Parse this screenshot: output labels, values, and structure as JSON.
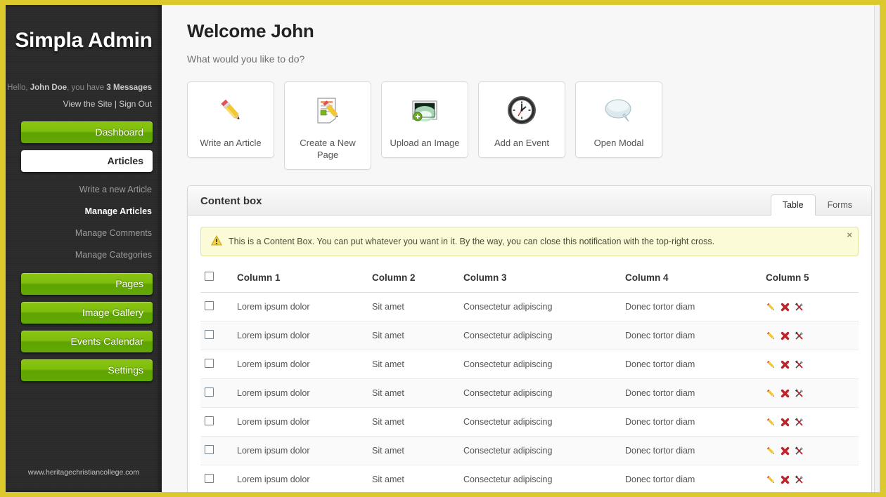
{
  "sidebar": {
    "brand": "Simpla Admin",
    "greeting_prefix": "Hello,",
    "user_name": "John Doe",
    "greeting_middle": ", you have",
    "messages": "3 Messages",
    "view_site": "View the Site",
    "separator": "|",
    "sign_out": "Sign Out",
    "nav": [
      {
        "label": "Dashboard",
        "type": "green"
      },
      {
        "label": "Articles",
        "type": "white-active"
      }
    ],
    "sub_items": [
      {
        "label": "Write a new Article",
        "current": false
      },
      {
        "label": "Manage Articles",
        "current": true
      },
      {
        "label": "Manage Comments",
        "current": false
      },
      {
        "label": "Manage Categories",
        "current": false
      }
    ],
    "nav_bottom": [
      {
        "label": "Pages"
      },
      {
        "label": "Image Gallery"
      },
      {
        "label": "Events Calendar"
      },
      {
        "label": "Settings"
      }
    ],
    "footer": "www.heritagechristiancollege.com"
  },
  "main": {
    "welcome": "Welcome John",
    "subtitle": "What would you like to do?",
    "cards": [
      {
        "label": "Write an Article",
        "icon": "pencil-icon"
      },
      {
        "label": "Create a New Page",
        "icon": "page-edit-icon"
      },
      {
        "label": "Upload an Image",
        "icon": "image-add-icon"
      },
      {
        "label": "Add an Event",
        "icon": "clock-icon"
      },
      {
        "label": "Open Modal",
        "icon": "speech-bubble-icon"
      }
    ],
    "contentbox": {
      "title": "Content box",
      "tabs": [
        {
          "label": "Table",
          "active": true
        },
        {
          "label": "Forms",
          "active": false
        }
      ],
      "notice": {
        "text": "This is a Content Box. You can put whatever you want in it. By the way, you can close this notification with the top-right cross.",
        "close_label": "×",
        "icon": "warning-triangle-icon"
      },
      "table": {
        "headers": [
          "Column 1",
          "Column 2",
          "Column 3",
          "Column 4",
          "Column 5"
        ],
        "rows": [
          {
            "c1": "Lorem ipsum dolor",
            "c2": "Sit amet",
            "c3": "Consectetur adipiscing",
            "c4": "Donec tortor diam"
          },
          {
            "c1": "Lorem ipsum dolor",
            "c2": "Sit amet",
            "c3": "Consectetur adipiscing",
            "c4": "Donec tortor diam"
          },
          {
            "c1": "Lorem ipsum dolor",
            "c2": "Sit amet",
            "c3": "Consectetur adipiscing",
            "c4": "Donec tortor diam"
          },
          {
            "c1": "Lorem ipsum dolor",
            "c2": "Sit amet",
            "c3": "Consectetur adipiscing",
            "c4": "Donec tortor diam"
          },
          {
            "c1": "Lorem ipsum dolor",
            "c2": "Sit amet",
            "c3": "Consectetur adipiscing",
            "c4": "Donec tortor diam"
          },
          {
            "c1": "Lorem ipsum dolor",
            "c2": "Sit amet",
            "c3": "Consectetur adipiscing",
            "c4": "Donec tortor diam"
          },
          {
            "c1": "Lorem ipsum dolor",
            "c2": "Sit amet",
            "c3": "Consectetur adipiscing",
            "c4": "Donec tortor diam"
          }
        ],
        "row_actions": [
          "edit-pencil-icon",
          "delete-cross-icon",
          "tools-icon"
        ]
      }
    }
  },
  "colors": {
    "frame": "#dcc92d",
    "sidebar_bg": "#2b2b2b",
    "green": "#7ebd0d",
    "link_green": "#7cb518",
    "notice_bg": "#fbfbd8"
  }
}
